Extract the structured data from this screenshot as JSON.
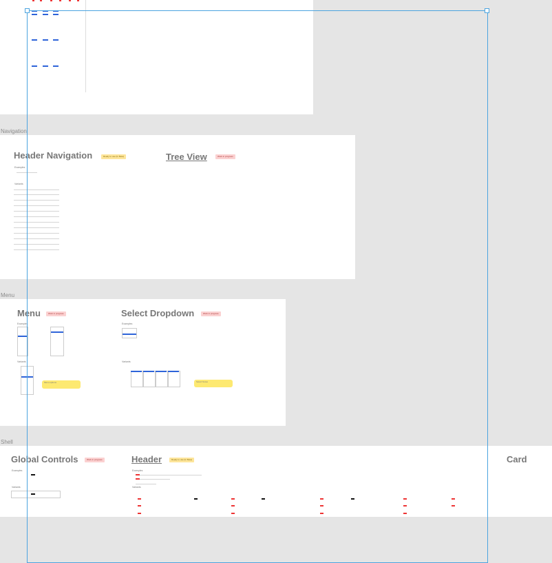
{
  "canvas": {
    "sections": {
      "navigation": "Navigation",
      "menu": "Menu",
      "shell": "Shell"
    },
    "frames": {
      "header_navigation": {
        "title": "Header Navigation",
        "tag": "Ready to use (In Beta)",
        "examples": "Examples",
        "variants": "Variants"
      },
      "tree_view": {
        "title": "Tree View",
        "tag": "Work in progress"
      },
      "menu": {
        "title": "Menu",
        "tag": "Work in progress",
        "examples": "Examples",
        "variants": "Variants",
        "note_title": "Menu options"
      },
      "select_dropdown": {
        "title": "Select Dropdown",
        "tag": "Work in progress",
        "examples": "Examples",
        "variants": "Variants",
        "note_title": "Select Notes"
      },
      "global_controls": {
        "title": "Global Controls",
        "tag": "Work in progress",
        "examples": "Examples",
        "variants": "Variants"
      },
      "header": {
        "title": "Header",
        "tag": "Ready to use (In Beta)",
        "examples": "Examples",
        "variants": "Variants"
      },
      "card": {
        "title": "Card"
      }
    }
  },
  "colors": {
    "canvas_bg": "#e5e5e5",
    "selection": "#4aa3df",
    "tag_red": "#fbd1d1",
    "tag_yellow": "#fde59b",
    "note": "#fde971",
    "accent_blue": "#2d63d9"
  }
}
